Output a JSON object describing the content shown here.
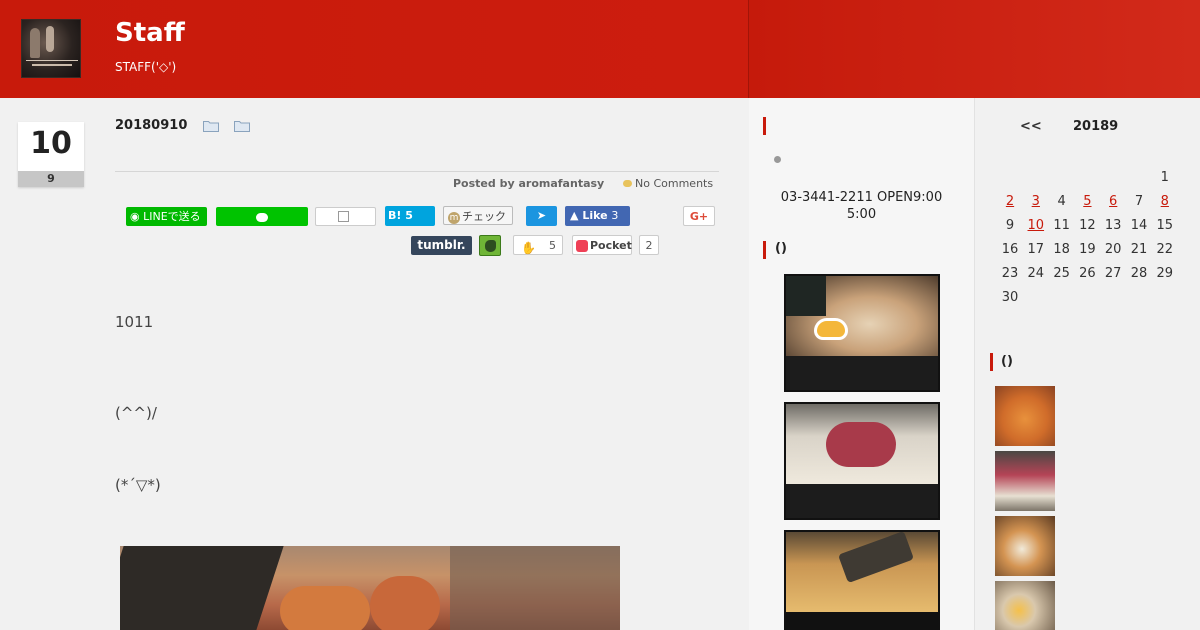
{
  "header": {
    "site_title": "Staff",
    "site_desc": "STAFF('◇')"
  },
  "post": {
    "date_day": "10",
    "date_month": "9",
    "title": "20180910",
    "posted_by_label": "Posted by",
    "author": "aromafantasy",
    "comments": "No Comments",
    "paragraphs": [
      "1011",
      "(^^)/",
      "(*´▽*)"
    ]
  },
  "share": {
    "line_label": "LINEで送る",
    "hatena_label": "B!",
    "hatena_count": "5",
    "mixi_label": "チェック",
    "fb_label": "Like",
    "fb_count": "3",
    "gplus_label": "G+",
    "tumblr_label": "tumblr.",
    "clap_count": "5",
    "pocket_label": "Pocket",
    "pocket_count": "2"
  },
  "sidebar": {
    "phone_line1": "03-3441-2211 OPEN9:00",
    "phone_line2": "5:00",
    "recent_title": "()",
    "gallery_title": "()"
  },
  "calendar": {
    "prev": "<<",
    "title": "20189",
    "weeks": [
      [
        {
          "d": "",
          "l": false
        },
        {
          "d": "",
          "l": false
        },
        {
          "d": "",
          "l": false
        },
        {
          "d": "",
          "l": false
        },
        {
          "d": "",
          "l": false
        },
        {
          "d": "",
          "l": false
        },
        {
          "d": "1",
          "l": false
        }
      ],
      [
        {
          "d": "2",
          "l": true
        },
        {
          "d": "3",
          "l": true
        },
        {
          "d": "4",
          "l": false
        },
        {
          "d": "5",
          "l": true
        },
        {
          "d": "6",
          "l": true
        },
        {
          "d": "7",
          "l": false
        },
        {
          "d": "8",
          "l": true
        }
      ],
      [
        {
          "d": "9",
          "l": false
        },
        {
          "d": "10",
          "l": true
        },
        {
          "d": "11",
          "l": false
        },
        {
          "d": "12",
          "l": false
        },
        {
          "d": "13",
          "l": false
        },
        {
          "d": "14",
          "l": false
        },
        {
          "d": "15",
          "l": false
        }
      ],
      [
        {
          "d": "16",
          "l": false
        },
        {
          "d": "17",
          "l": false
        },
        {
          "d": "18",
          "l": false
        },
        {
          "d": "19",
          "l": false
        },
        {
          "d": "20",
          "l": false
        },
        {
          "d": "21",
          "l": false
        },
        {
          "d": "22",
          "l": false
        }
      ],
      [
        {
          "d": "23",
          "l": false
        },
        {
          "d": "24",
          "l": false
        },
        {
          "d": "25",
          "l": false
        },
        {
          "d": "26",
          "l": false
        },
        {
          "d": "27",
          "l": false
        },
        {
          "d": "28",
          "l": false
        },
        {
          "d": "29",
          "l": false
        }
      ],
      [
        {
          "d": "30",
          "l": false
        },
        {
          "d": "",
          "l": false
        },
        {
          "d": "",
          "l": false
        },
        {
          "d": "",
          "l": false
        },
        {
          "d": "",
          "l": false
        },
        {
          "d": "",
          "l": false
        },
        {
          "d": "",
          "l": false
        }
      ]
    ]
  },
  "colors": {
    "accent": "#c81a0b",
    "header": "#c81a0b"
  }
}
